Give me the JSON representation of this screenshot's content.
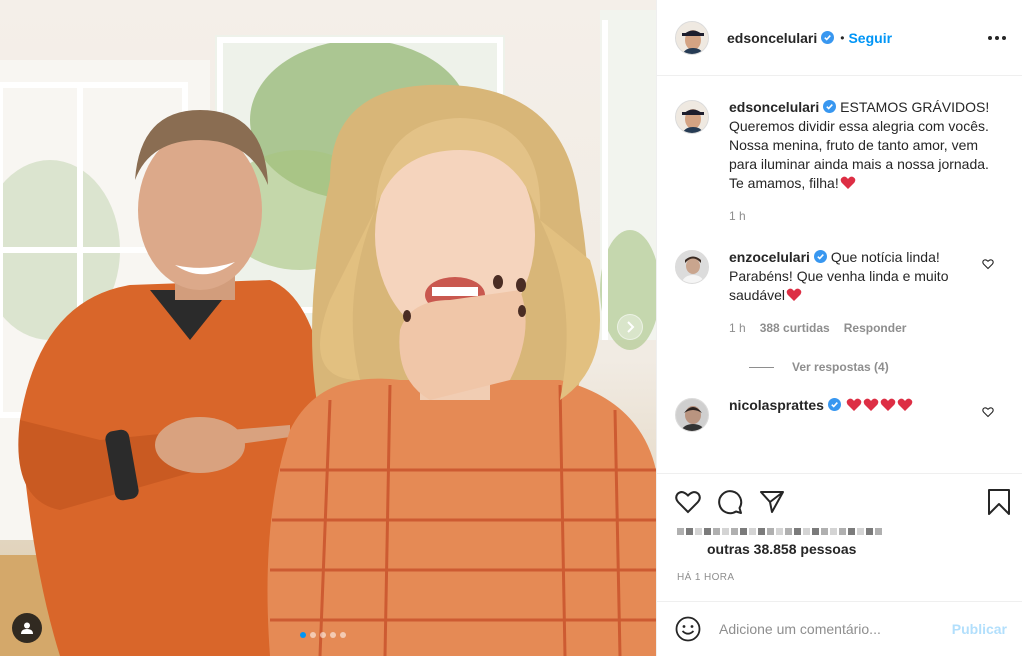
{
  "post": {
    "author": "edsoncelulari",
    "follow_label": "Seguir",
    "separator": "•",
    "carousel": {
      "slides": 5,
      "active_index": 0
    }
  },
  "caption": {
    "username": "edsoncelulari",
    "lines": [
      "ESTAMOS GRÁVIDOS!",
      "Queremos dividir essa alegria com vocês.",
      "Nossa menina, fruto de tanto amor, vem para iluminar ainda mais a nossa jornada.",
      "Te amamos, filha!"
    ],
    "time": "1 h"
  },
  "comments": [
    {
      "username": "enzocelulari",
      "text": "Que notícia linda! Parabéns! Que venha linda e muito saudável",
      "time": "1 h",
      "likes": "388 curtidas",
      "reply_label": "Responder",
      "view_replies": "Ver respostas (4)"
    },
    {
      "username": "nicolasprattes",
      "text": ""
    }
  ],
  "likes_summary": "outras 38.858 pessoas",
  "timestamp": "HÁ 1 HORA",
  "add_comment": {
    "placeholder": "Adicione um comentário...",
    "publish_label": "Publicar"
  },
  "colors": {
    "accent": "#0095f6",
    "publish_disabled": "#b2dffc",
    "heart": "#ed4956"
  },
  "icons": [
    "more-options-icon",
    "verified-badge-icon",
    "heart-icon",
    "comment-icon",
    "share-icon",
    "bookmark-icon",
    "emoji-icon",
    "user-tag-icon",
    "next-arrow-icon"
  ]
}
